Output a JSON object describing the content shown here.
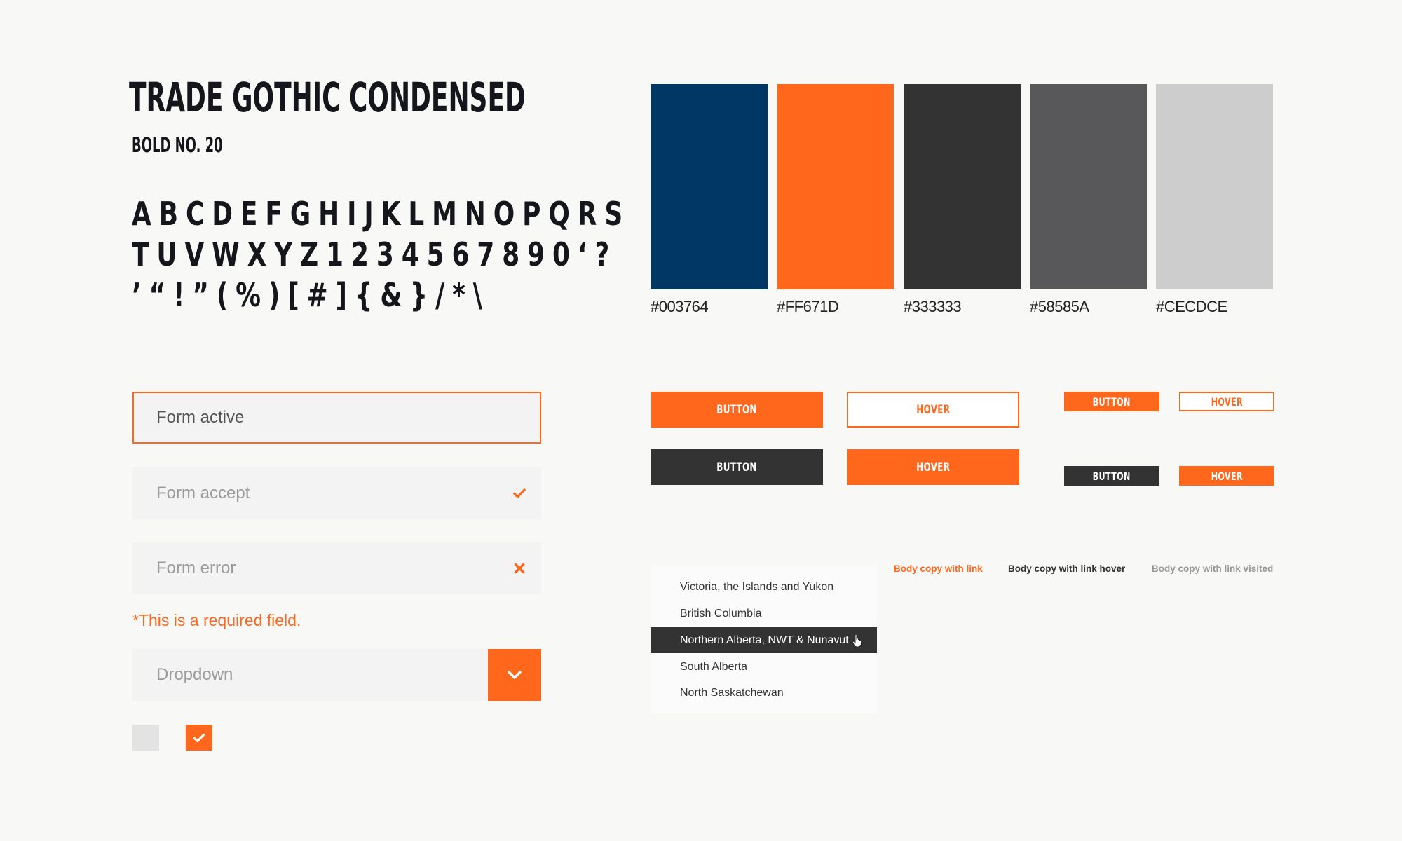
{
  "typography": {
    "font_name": "TRADE GOTHIC CONDENSED",
    "weight": "BOLD NO. 20",
    "glyph_rows": [
      "ABCDEFGHIJKLMNOPQRS",
      "TUVWXYZ1234567890‘?",
      "’“!”(%)[#]{&}/*\\"
    ]
  },
  "palette": [
    {
      "hex": "#003764",
      "label": "#003764"
    },
    {
      "hex": "#FF671D",
      "label": "#FF671D"
    },
    {
      "hex": "#333333",
      "label": "#333333"
    },
    {
      "hex": "#58585A",
      "label": "#58585A"
    },
    {
      "hex": "#CECDCE",
      "label": "#CECDCE"
    }
  ],
  "forms": {
    "active": {
      "value": "Form active"
    },
    "accept": {
      "placeholder": "Form accept",
      "icon": "check-icon"
    },
    "error": {
      "placeholder": "Form error",
      "icon": "x-icon"
    },
    "error_message": "*This is a required field.",
    "dropdown": {
      "placeholder": "Dropdown",
      "icon": "chevron-down-icon"
    },
    "checkboxes": [
      {
        "checked": false
      },
      {
        "checked": true
      }
    ]
  },
  "buttons": {
    "large": {
      "primary": "BUTTON",
      "primary_hover": "HOVER",
      "secondary": "BUTTON",
      "secondary_hover": "HOVER"
    },
    "small": {
      "primary": "BUTTON",
      "primary_hover": "HOVER",
      "secondary": "BUTTON",
      "secondary_hover": "HOVER"
    }
  },
  "region_list": {
    "items": [
      "Victoria, the Islands and Yukon",
      "British Columbia",
      "Northern Alberta, NWT & Nunavut",
      "South Alberta",
      "North Saskatchewan"
    ],
    "selected_index": 2
  },
  "links": {
    "default": "Body copy with link",
    "hover": "Body copy with link hover",
    "visited": "Body copy with link visited"
  },
  "colors": {
    "accent": "#FF671D",
    "dark": "#333333",
    "field_bg": "#F3F3F3",
    "page_bg": "#F8F8F7"
  }
}
